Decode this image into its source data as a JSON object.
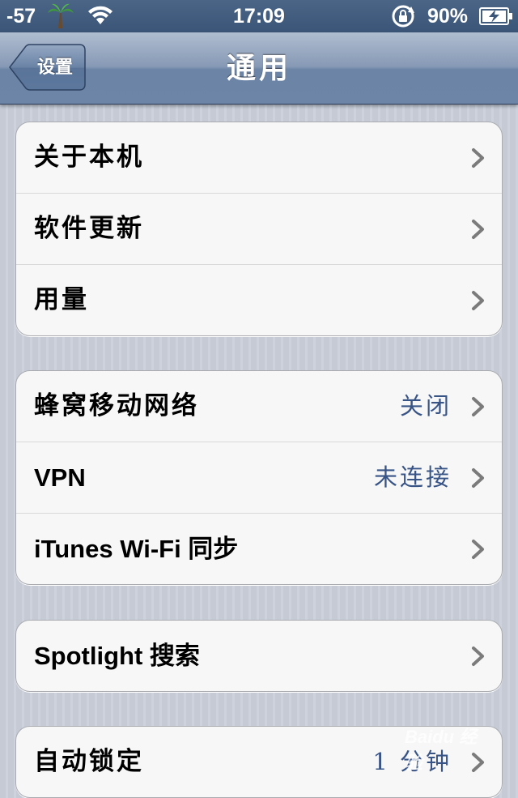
{
  "status_bar": {
    "signal": "-57",
    "carrier_icon": "palm-tree-icon",
    "time": "17:09",
    "battery_percent": "90%"
  },
  "nav": {
    "back_label": "设置",
    "title": "通用"
  },
  "groups": [
    {
      "rows": [
        {
          "label": "关于本机"
        },
        {
          "label": "软件更新"
        },
        {
          "label": "用量"
        }
      ]
    },
    {
      "rows": [
        {
          "label": "蜂窝移动网络",
          "value": "关闭"
        },
        {
          "label": "VPN",
          "value": "未连接"
        },
        {
          "label": "iTunes Wi-Fi 同步"
        }
      ]
    },
    {
      "rows": [
        {
          "label": "Spotlight 搜索"
        }
      ]
    },
    {
      "rows": [
        {
          "label": "自动锁定",
          "value": "1 分钟"
        }
      ]
    }
  ],
  "watermark": "Baidu 经验",
  "colors": {
    "value_text": "#385487",
    "nav_bar": "#6d86a8",
    "status_bar": "#3b5578"
  }
}
